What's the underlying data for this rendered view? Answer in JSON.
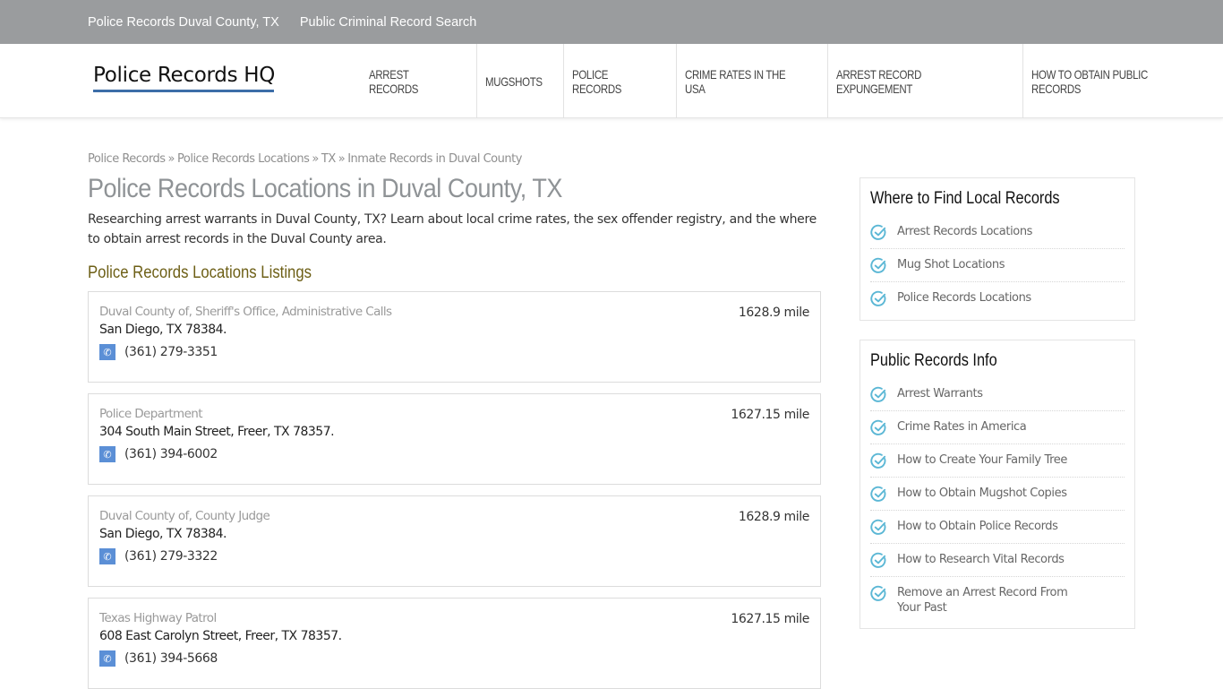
{
  "topbar": {
    "links": [
      "Police Records Duval County, TX",
      "Public Criminal Record Search"
    ]
  },
  "header": {
    "logo": "Police Records HQ",
    "nav": [
      "ARREST RECORDS",
      "MUGSHOTS",
      "POLICE RECORDS",
      "CRIME RATES IN THE USA",
      "ARREST RECORD EXPUNGEMENT",
      "HOW TO OBTAIN PUBLIC RECORDS"
    ]
  },
  "breadcrumb": [
    "Police Records",
    "Police Records Locations",
    "TX",
    "Inmate Records in Duval County"
  ],
  "breadcrumb_separator": "»",
  "page": {
    "title": "Police Records Locations in Duval County, TX",
    "intro": "Researching arrest warrants in Duval County, TX? Learn about local crime rates, the sex offender registry, and the where to obtain arrest records in the Duval County area.",
    "listings_heading": "Police Records Locations Listings"
  },
  "listings": [
    {
      "name": "Duval County of, Sheriff's Office, Administrative Calls",
      "address": "San Diego, TX 78384.",
      "phone": "(361) 279-3351",
      "distance": "1628.9 mile"
    },
    {
      "name": "Police Department",
      "address": "304 South Main Street, Freer, TX 78357.",
      "phone": "(361) 394-6002",
      "distance": "1627.15 mile"
    },
    {
      "name": "Duval County of, County Judge",
      "address": "San Diego, TX 78384.",
      "phone": "(361) 279-3322",
      "distance": "1628.9 mile"
    },
    {
      "name": "Texas Highway Patrol",
      "address": "608 East Carolyn Street, Freer, TX 78357.",
      "phone": "(361) 394-5668",
      "distance": "1627.15 mile"
    }
  ],
  "sidebar": {
    "widgets": [
      {
        "title": "Where to Find Local Records",
        "items": [
          "Arrest Records Locations",
          "Mug Shot Locations",
          "Police Records Locations"
        ]
      },
      {
        "title": "Public Records Info",
        "items": [
          "Arrest Warrants",
          "Crime Rates in America",
          "How to Create Your Family Tree",
          "How to Obtain Mugshot Copies",
          "How to Obtain Police Records",
          "How to Research Vital Records",
          "Remove an Arrest Record From Your Past"
        ]
      }
    ]
  },
  "colors": {
    "topbar_bg": "#9a9c9e",
    "logo_underline": "#3d6ea8",
    "heading_olive": "#6d5f16",
    "phone_icon_bg": "#5b8fd6",
    "check_icon": "#5bb7d5"
  },
  "icons": {
    "phone": "phone-icon",
    "check": "check-circle-icon"
  }
}
